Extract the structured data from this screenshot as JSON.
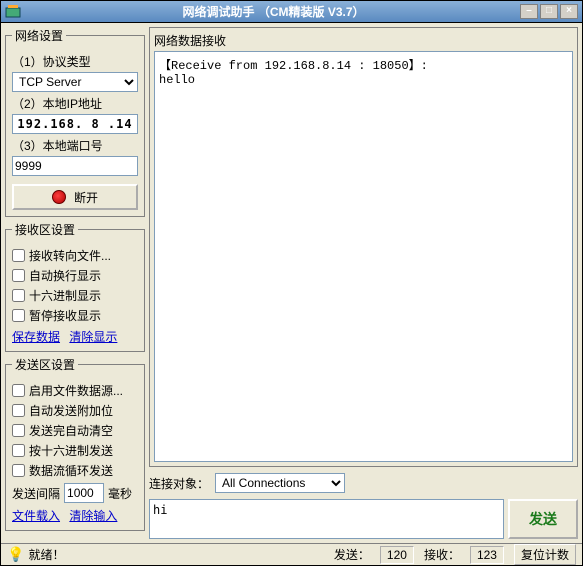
{
  "titlebar": {
    "title": "网络调试助手 （CM精装版 V3.7）",
    "min": "–",
    "max": "□",
    "close": "×"
  },
  "network": {
    "legend": "网络设置",
    "proto_label": "（1）协议类型",
    "proto_value": "TCP Server",
    "ip_label": "（2）本地IP地址",
    "ip_value": "192.168. 8 .14",
    "port_label": "（3）本地端口号",
    "port_value": "9999",
    "disconnect": "断开"
  },
  "rxset": {
    "legend": "接收区设置",
    "opts": [
      "接收转向文件...",
      "自动换行显示",
      "十六进制显示",
      "暂停接收显示"
    ],
    "save": "保存数据",
    "clear": "清除显示"
  },
  "txset": {
    "legend": "发送区设置",
    "opts": [
      "启用文件数据源...",
      "自动发送附加位",
      "发送完自动清空",
      "按十六进制发送",
      "数据流循环发送"
    ],
    "interval_label": "发送间隔",
    "interval_value": "1000",
    "interval_unit": "毫秒",
    "load": "文件载入",
    "clear": "清除输入"
  },
  "rx": {
    "legend": "网络数据接收",
    "content": "【Receive from 192.168.8.14 : 18050】:\nhello"
  },
  "conn": {
    "label": "连接对象：",
    "value": "All Connections"
  },
  "tx": {
    "value": "hi",
    "send": "发送"
  },
  "status": {
    "ready": "就绪！",
    "send_label": "发送：",
    "send_count": "120",
    "recv_label": "接收：",
    "recv_count": "123",
    "reset": "复位计数"
  }
}
